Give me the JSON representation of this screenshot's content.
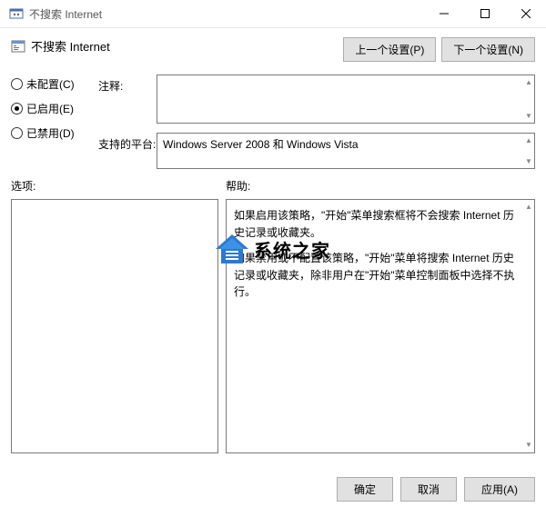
{
  "titlebar": {
    "title": "不搜索 Internet"
  },
  "header": {
    "title": "不搜索 Internet",
    "prev_setting": "上一个设置(P)",
    "next_setting": "下一个设置(N)"
  },
  "radios": {
    "not_configured": "未配置(C)",
    "enabled": "已启用(E)",
    "disabled": "已禁用(D)",
    "selected": "enabled"
  },
  "info": {
    "comment_label": "注释:",
    "comment_value": "",
    "platforms_label": "支持的平台:",
    "platforms_value": "Windows Server 2008 和 Windows Vista"
  },
  "sections": {
    "options_label": "选项:",
    "help_label": "帮助:"
  },
  "help": {
    "p1": "如果启用该策略，\"开始\"菜单搜索框将不会搜索 Internet 历史记录或收藏夹。",
    "p2": "如果禁用或不配置该策略，\"开始\"菜单将搜索 Internet 历史记录或收藏夹，除非用户在\"开始\"菜单控制面板中选择不执行。"
  },
  "buttons": {
    "ok": "确定",
    "cancel": "取消",
    "apply": "应用(A)"
  },
  "watermark": {
    "text": "系统之家"
  }
}
